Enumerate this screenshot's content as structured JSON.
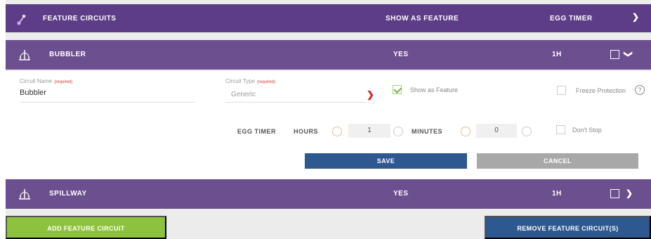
{
  "header": {
    "title": "FEATURE CIRCUITS",
    "col_show": "SHOW AS FEATURE",
    "col_egg": "EGG TIMER",
    "icon": "wand-icon",
    "chevron": "chevron-down-icon"
  },
  "circuits": [
    {
      "name": "BUBBLER",
      "show": "YES",
      "egg": "1H",
      "icon": "fountain-icon",
      "chevron": "chevron-down-icon",
      "expanded": true
    },
    {
      "name": "SPILLWAY",
      "show": "YES",
      "egg": "1H",
      "icon": "fountain-icon",
      "chevron": "chevron-right-icon",
      "expanded": false
    }
  ],
  "detail": {
    "circuit_name_label": "Circuit Name",
    "circuit_name_req": "(required)",
    "circuit_name_value": "Bubbler",
    "circuit_type_label": "Circuit Type",
    "circuit_type_req": "(required)",
    "circuit_type_value": "Generic",
    "show_as_feature_label": "Show as Feature",
    "show_as_feature_checked": true,
    "freeze_label": "Freeze Protection",
    "freeze_checked": false,
    "egg_timer_label": "EGG TIMER",
    "hours_label": "HOURS",
    "hours_value": "1",
    "minutes_label": "MINUTES",
    "minutes_value": "0",
    "dont_stop_label": "Don't Stop",
    "dont_stop_checked": false,
    "save_label": "SAVE",
    "cancel_label": "CANCEL"
  },
  "footer": {
    "add_label": "ADD FEATURE CIRCUIT",
    "remove_label": "REMOVE FEATURE CIRCUIT(S)"
  },
  "colors": {
    "header_bg": "#5e3d88",
    "row_bg": "#6c4f8f",
    "save_bg": "#2e5890",
    "cancel_bg": "#a8a8a8",
    "add_bg": "#8dc23d",
    "remove_bg": "#2e5890"
  }
}
